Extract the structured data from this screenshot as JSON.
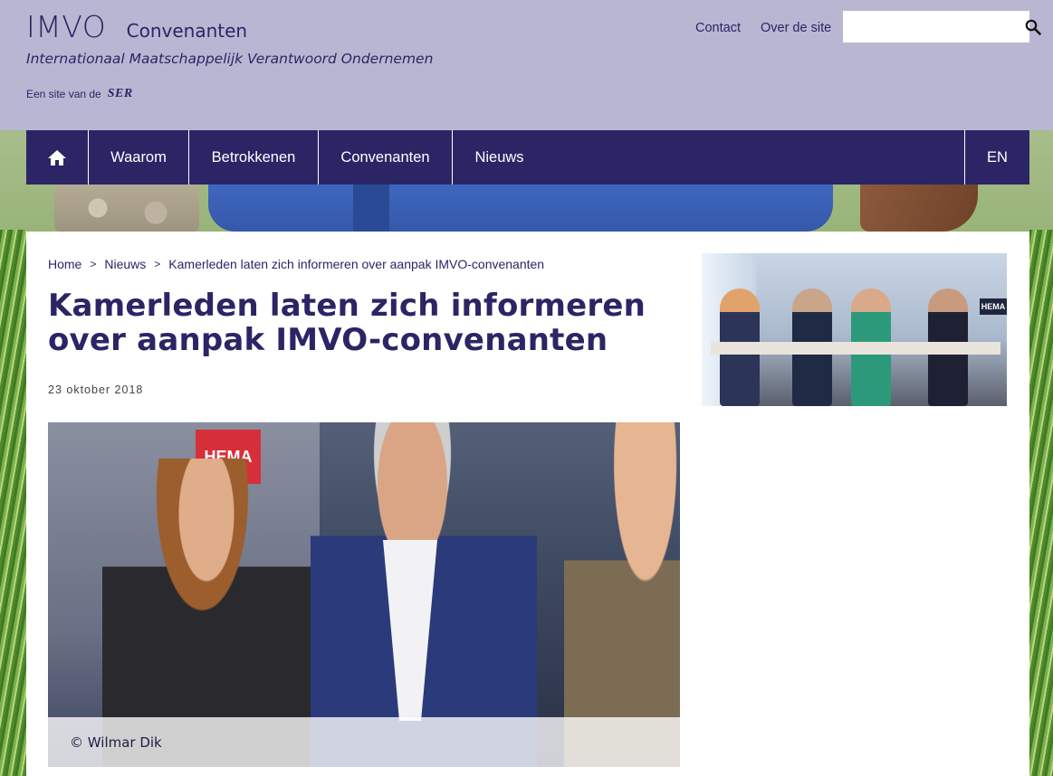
{
  "header": {
    "logo": "IMVO",
    "logo_sub": "Convenanten",
    "tagline": "Internationaal Maatschappelijk Verantwoord Ondernemen",
    "site_of_label": "Een site van de",
    "ser_logo": "SER",
    "links": [
      "Contact",
      "Over de site"
    ],
    "search": {
      "placeholder": "",
      "value": "",
      "icon": "search-icon"
    }
  },
  "nav": {
    "home_icon": "home-icon",
    "items": [
      "Waarom",
      "Betrokkenen",
      "Convenanten",
      "Nieuws"
    ],
    "language": "EN"
  },
  "breadcrumb": [
    "Home",
    "Nieuws",
    "Kamerleden laten zich informeren over aanpak IMVO-convenanten"
  ],
  "article": {
    "title": "Kamerleden laten zich informeren over aanpak IMVO-convenanten",
    "date": "23 oktober 2018",
    "photo_credit": "© Wilmar Dik",
    "photo_sign": "HEMA",
    "side_photo_sign": "HEMA"
  },
  "colors": {
    "header_bg": "#b9b6d3",
    "brand": "#2b2565",
    "nav_bg": "#2b2565",
    "nav_text": "#ffffff"
  }
}
